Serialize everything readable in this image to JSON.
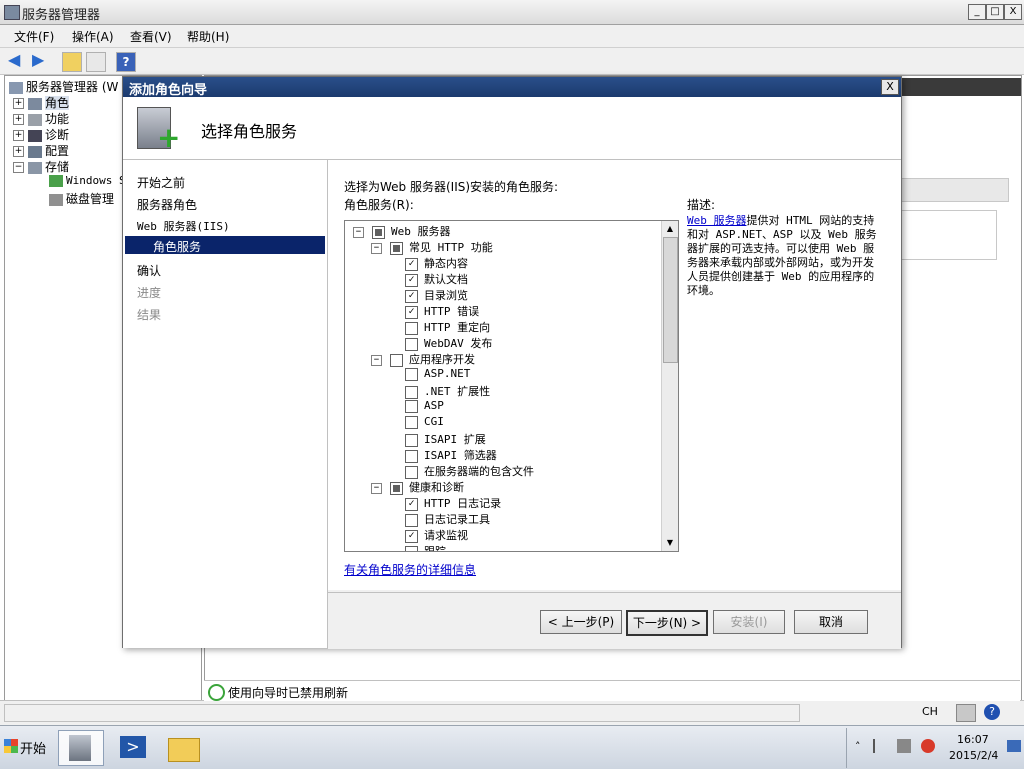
{
  "window": {
    "title": "服务器管理器",
    "min": "_",
    "max": "□",
    "close": "X"
  },
  "menu": [
    "文件(F)",
    "操作(A)",
    "查看(V)",
    "帮助(H)"
  ],
  "tree": {
    "root": "服务器管理器 (W",
    "items": [
      "角色",
      "功能",
      "诊断",
      "配置",
      "存储"
    ],
    "storage_children": [
      "Windows S",
      "磁盘管理"
    ]
  },
  "status": {
    "text": "使用向导时已禁用刷新",
    "lang": "CH"
  },
  "wizard": {
    "title": "添加角色向导",
    "close": "X",
    "heading": "选择角色服务",
    "nav": [
      "开始之前",
      "服务器角色",
      "Web 服务器(IIS)",
      "角色服务",
      "确认",
      "进度",
      "结果"
    ],
    "prompt": "选择为Web 服务器(IIS)安装的角色服务:",
    "list_label": "角色服务(R):",
    "description_label": "描述:",
    "description_link": "Web 服务器",
    "description_text": "提供对 HTML 网站的支持和对 ASP.NET、ASP 以及 Web 服务器扩展的可选支持。可以使用 Web 服务器来承载内部或外部网站，或为开发人员提供创建基于 Web 的应用程序的环境。",
    "more_info_link": "有关角色服务的详细信息",
    "buttons": {
      "back": "< 上一步(P)",
      "next": "下一步(N) >",
      "install": "安装(I)",
      "cancel": "取消"
    },
    "services": [
      {
        "label": "Web 服务器",
        "level": 0,
        "state": "partial",
        "expander": "−"
      },
      {
        "label": "常见 HTTP 功能",
        "level": 1,
        "state": "partial",
        "expander": "−"
      },
      {
        "label": "静态内容",
        "level": 2,
        "state": "checked"
      },
      {
        "label": "默认文档",
        "level": 2,
        "state": "checked"
      },
      {
        "label": "目录浏览",
        "level": 2,
        "state": "checked"
      },
      {
        "label": "HTTP 错误",
        "level": 2,
        "state": "checked"
      },
      {
        "label": "HTTP 重定向",
        "level": 2,
        "state": "unchecked"
      },
      {
        "label": "WebDAV 发布",
        "level": 2,
        "state": "unchecked"
      },
      {
        "label": "应用程序开发",
        "level": 1,
        "state": "unchecked",
        "expander": "−"
      },
      {
        "label": "ASP.NET",
        "level": 2,
        "state": "unchecked"
      },
      {
        "label": ".NET 扩展性",
        "level": 2,
        "state": "unchecked"
      },
      {
        "label": "ASP",
        "level": 2,
        "state": "unchecked"
      },
      {
        "label": "CGI",
        "level": 2,
        "state": "unchecked"
      },
      {
        "label": "ISAPI 扩展",
        "level": 2,
        "state": "unchecked"
      },
      {
        "label": "ISAPI 筛选器",
        "level": 2,
        "state": "unchecked"
      },
      {
        "label": "在服务器端的包含文件",
        "level": 2,
        "state": "unchecked"
      },
      {
        "label": "健康和诊断",
        "level": 1,
        "state": "partial",
        "expander": "−"
      },
      {
        "label": "HTTP 日志记录",
        "level": 2,
        "state": "checked"
      },
      {
        "label": "日志记录工具",
        "level": 2,
        "state": "unchecked"
      },
      {
        "label": "请求监视",
        "level": 2,
        "state": "checked"
      },
      {
        "label": "跟踪",
        "level": 2,
        "state": "unchecked"
      }
    ]
  },
  "taskbar": {
    "start": "开始",
    "time": "16:07",
    "date": "2015/2/4"
  },
  "colors": {
    "nav_selected": "#0a246a",
    "titlebar": "#1b3a6e",
    "link": "#0000cc"
  }
}
